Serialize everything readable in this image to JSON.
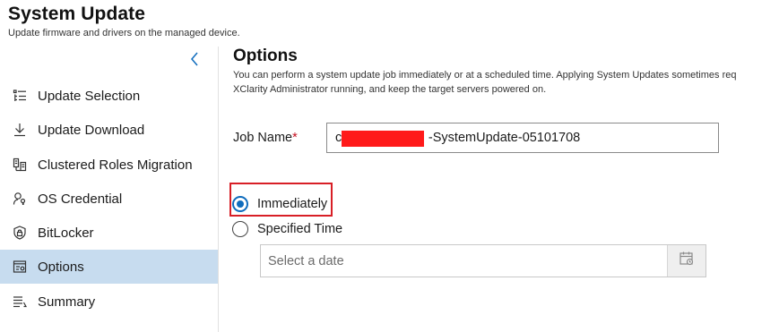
{
  "header": {
    "title": "System Update",
    "subtitle": "Update firmware and drivers on the managed device."
  },
  "sidebar": {
    "collapse_icon": "chevron-left-icon",
    "active_item": "Options",
    "items": [
      {
        "label": "Update Selection",
        "icon": "list-icon"
      },
      {
        "label": "Update Download",
        "icon": "download-icon"
      },
      {
        "label": "Clustered Roles Migration",
        "icon": "cluster-icon"
      },
      {
        "label": "OS Credential",
        "icon": "key-person-icon"
      },
      {
        "label": "BitLocker",
        "icon": "shield-lock-icon"
      },
      {
        "label": "Options",
        "icon": "settings-window-icon"
      },
      {
        "label": "Summary",
        "icon": "summary-list-icon"
      }
    ]
  },
  "options": {
    "title": "Options",
    "description_line1": "You can perform a system update job immediately or at a scheduled time. Applying System Updates sometimes req",
    "description_line2": "XClarity Administrator running, and keep the target servers powered on.",
    "job_name_label": "Job Name",
    "job_name_required_mark": "*",
    "job_name_value": "c                        -SystemUpdate-05101708",
    "schedule": {
      "immediately_label": "Immediately",
      "specified_time_label": "Specified Time",
      "selected": "Immediately",
      "date_placeholder": "Select a date"
    }
  },
  "colors": {
    "accent": "#0f6cbd",
    "active_nav_bg": "#c7dcef",
    "highlight_border": "#d81f26",
    "redaction": "#ff1a1a",
    "required": "#c50f1f"
  }
}
